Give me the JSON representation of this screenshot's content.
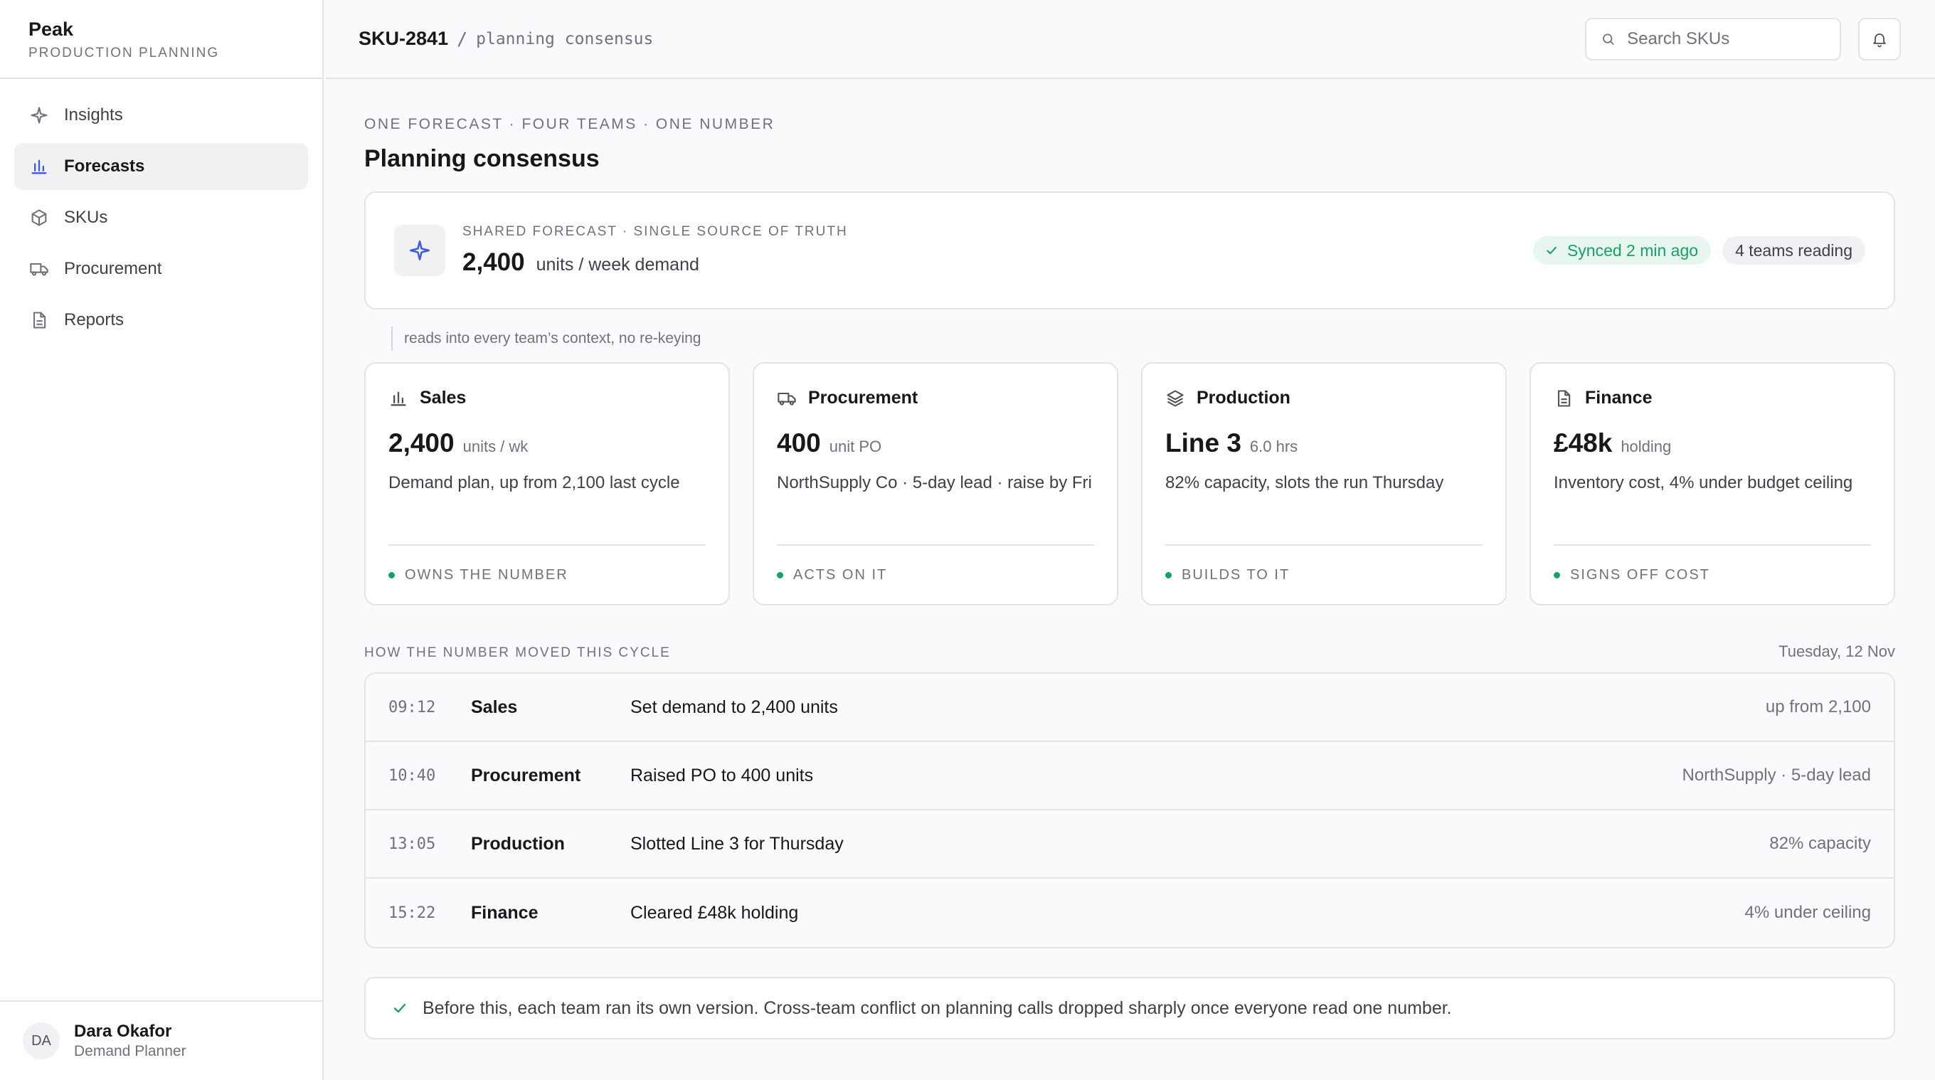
{
  "brand": {
    "name": "Peak",
    "subtitle": "PRODUCTION PLANNING"
  },
  "nav": {
    "items": [
      {
        "label": "Insights",
        "icon": "sparkle-icon",
        "active": false
      },
      {
        "label": "Forecasts",
        "icon": "bar-chart-icon",
        "active": true
      },
      {
        "label": "SKUs",
        "icon": "box-icon",
        "active": false
      },
      {
        "label": "Procurement",
        "icon": "truck-icon",
        "active": false
      },
      {
        "label": "Reports",
        "icon": "document-icon",
        "active": false
      }
    ]
  },
  "user": {
    "initials": "DA",
    "name": "Dara Okafor",
    "role": "Demand Planner"
  },
  "header": {
    "sku": "SKU-2841",
    "separator": "/",
    "page": "planning consensus",
    "search_placeholder": "Search SKUs"
  },
  "page": {
    "eyebrow": "ONE FORECAST · FOUR TEAMS · ONE NUMBER",
    "title": "Planning consensus"
  },
  "shared": {
    "label": "SHARED FORECAST · SINGLE SOURCE OF TRUTH",
    "value": "2,400",
    "unit": "units / week demand",
    "sync_badge": "Synced 2 min ago",
    "teams_badge": "4 teams reading",
    "note": "reads into every team’s context, no re-keying"
  },
  "teams": [
    {
      "name": "Sales",
      "icon": "bar-chart-icon",
      "value": "2,400",
      "unit": "units / wk",
      "desc": "Demand plan, up from 2,100 last cycle",
      "role": "OWNS THE NUMBER"
    },
    {
      "name": "Procurement",
      "icon": "truck-icon",
      "value": "400",
      "unit": "unit PO",
      "desc": "NorthSupply Co · 5-day lead · raise by Fri",
      "role": "ACTS ON IT"
    },
    {
      "name": "Production",
      "icon": "layers-icon",
      "value": "Line 3",
      "unit": "6.0 hrs",
      "desc": "82% capacity, slots the run Thursday",
      "role": "BUILDS TO IT"
    },
    {
      "name": "Finance",
      "icon": "document-icon",
      "value": "£48k",
      "unit": "holding",
      "desc": "Inventory cost, 4% under budget ceiling",
      "role": "SIGNS OFF COST"
    }
  ],
  "timeline": {
    "label": "HOW THE NUMBER MOVED THIS CYCLE",
    "date": "Tuesday, 12 Nov",
    "rows": [
      {
        "time": "09:12",
        "team": "Sales",
        "action": "Set demand to 2,400 units",
        "note": "up from 2,100"
      },
      {
        "time": "10:40",
        "team": "Procurement",
        "action": "Raised PO to 400 units",
        "note": "NorthSupply · 5-day lead"
      },
      {
        "time": "13:05",
        "team": "Production",
        "action": "Slotted Line 3 for Thursday",
        "note": "82% capacity"
      },
      {
        "time": "15:22",
        "team": "Finance",
        "action": "Cleared £48k holding",
        "note": "4% under ceiling"
      }
    ]
  },
  "footer_note": "Before this, each team ran its own version. Cross-team conflict on planning calls dropped sharply once everyone read one number.",
  "colors": {
    "accent": "#3b5bdb",
    "success": "#16a06a",
    "border": "#e4e4e7"
  }
}
